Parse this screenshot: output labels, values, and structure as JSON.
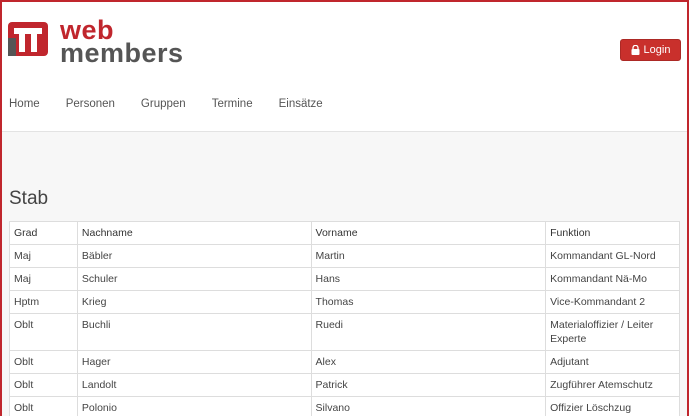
{
  "header": {
    "logo": {
      "word1": "web",
      "word2": "members"
    },
    "login_label": "Login"
  },
  "nav": {
    "items": [
      "Home",
      "Personen",
      "Gruppen",
      "Termine",
      "Einsätze"
    ]
  },
  "page": {
    "title": "Stab"
  },
  "table": {
    "columns": [
      "Grad",
      "Nachname",
      "Vorname",
      "Funktion"
    ],
    "rows": [
      [
        "Maj",
        "Bäbler",
        "Martin",
        "Kommandant GL-Nord"
      ],
      [
        "Maj",
        "Schuler",
        "Hans",
        "Kommandant Nä-Mo"
      ],
      [
        "Hptm",
        "Krieg",
        "Thomas",
        "Vice-Kommandant 2"
      ],
      [
        "Oblt",
        "Buchli",
        "Ruedi",
        "Materialoffizier / Leiter Experte"
      ],
      [
        "Oblt",
        "Hager",
        "Alex",
        "Adjutant"
      ],
      [
        "Oblt",
        "Landolt",
        "Patrick",
        "Zugführer Atemschutz"
      ],
      [
        "Oblt",
        "Polonio",
        "Silvano",
        "Offizier Löschzug"
      ]
    ]
  },
  "colors": {
    "brand_red": "#c0262d",
    "button_red": "#c9302c",
    "logo_gray": "#555555"
  }
}
